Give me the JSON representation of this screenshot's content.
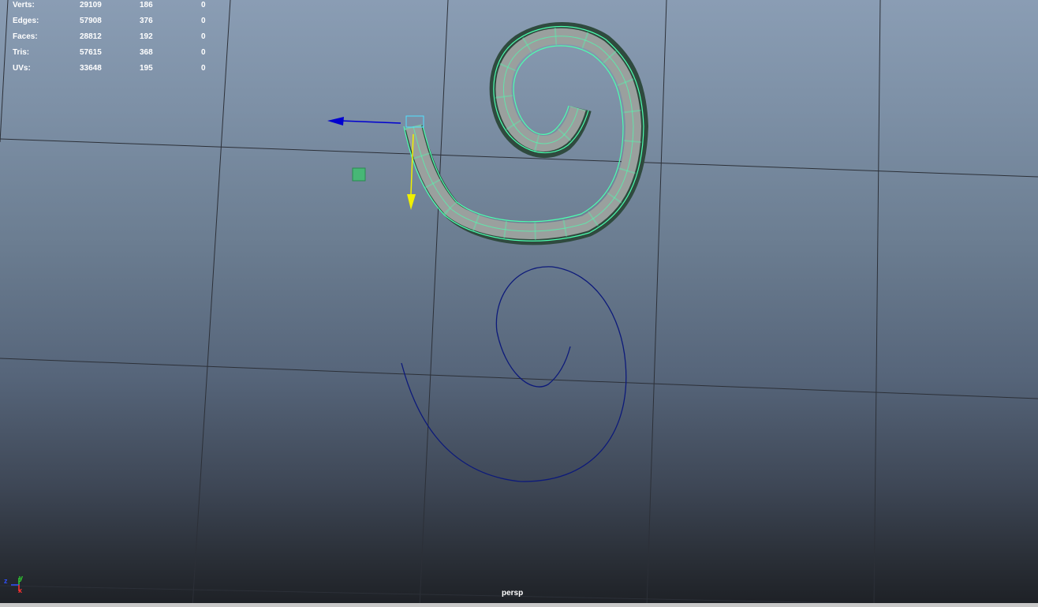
{
  "viewport": {
    "camera_label": "persp"
  },
  "hud": {
    "rows": [
      {
        "label": "Verts:",
        "total": "29109",
        "selected": "186",
        "components": "0"
      },
      {
        "label": "Edges:",
        "total": "57908",
        "selected": "376",
        "components": "0"
      },
      {
        "label": "Faces:",
        "total": "28812",
        "selected": "192",
        "components": "0"
      },
      {
        "label": "Tris:",
        "total": "57615",
        "selected": "368",
        "components": "0"
      },
      {
        "label": "UVs:",
        "total": "33648",
        "selected": "195",
        "components": "0"
      }
    ]
  },
  "axis_triad": {
    "x_label": "x",
    "y_label": "y",
    "z_label": "z",
    "colors": {
      "x": "#ff3030",
      "y": "#30d030",
      "z": "#3050ff"
    }
  },
  "colors": {
    "grid_line": "#2c3038",
    "mesh_face": "#9aa09e",
    "mesh_edge": "#4dffb0",
    "curve": "#0d1a7a",
    "manipulator_x": "#0000d0",
    "manipulator_y": "#f0f000",
    "pivot": "#40c070",
    "selection_box": "#50e0ff"
  }
}
